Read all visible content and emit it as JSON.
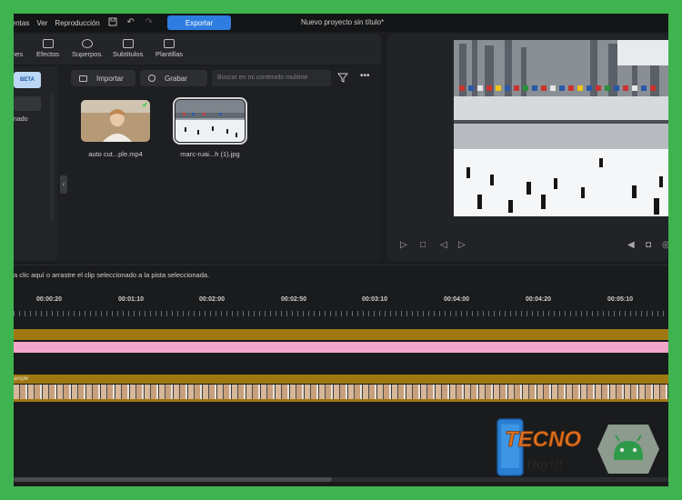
{
  "menu": {
    "items": [
      "ientas",
      "Ver",
      "Reproducción"
    ],
    "export_label": "Exportar",
    "project_title": "Nuevo proyecto sin título*"
  },
  "toolbar": {
    "items": [
      {
        "label": "nes",
        "icon": "transitions-icon"
      },
      {
        "label": "Efectos",
        "icon": "effects-icon"
      },
      {
        "label": "Superpos.",
        "icon": "overlays-icon"
      },
      {
        "label": "Subtítulos",
        "icon": "subtitles-icon"
      },
      {
        "label": "Plantillas",
        "icon": "templates-icon"
      }
    ]
  },
  "sidebar": {
    "badge": "BETA",
    "item_text": "nado"
  },
  "media": {
    "import_label": "Importar",
    "record_label": "Grabar",
    "search_placeholder": "Buscar en mi contenido multime",
    "files": [
      {
        "name": "auto cut...ple.mp4",
        "imported": true
      },
      {
        "name": "marc-ruai...h (1).jpg",
        "selected": true
      }
    ]
  },
  "hint": "a clic aquí o arrastre el clip seleccionado a la pista seleccionada.",
  "timeline": {
    "ticks": [
      "00:00:20",
      "00:01:10",
      "00:02:00",
      "00:02:50",
      "00:03:10",
      "00:04:00",
      "00:04:20",
      "00:05:10"
    ],
    "clip_label": "ample"
  },
  "watermark": {
    "text_line1": "TECNO",
    "text_line2": "Hoy!!!"
  },
  "colors": {
    "accent": "#2f7de1",
    "border_green": "#3fb34f",
    "track_gold": "#a07812",
    "track_pink": "#f3a6c9"
  }
}
